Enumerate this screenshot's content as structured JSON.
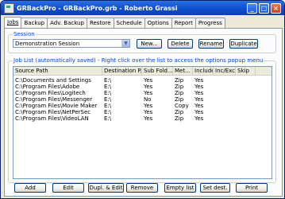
{
  "window": {
    "title": "GRBackPro - GRBackPro.grb - Roberto Grassi"
  },
  "window_controls": {
    "minimize": "_",
    "maximize": "□",
    "close": "×"
  },
  "tabs": [
    "Jobs",
    "Backup",
    "Adv. Backup",
    "Restore",
    "Schedule",
    "Options",
    "Report",
    "Progress"
  ],
  "session": {
    "label": "Session",
    "selected": "Demonstration Session",
    "buttons": {
      "new": "New...",
      "delete": "Delete",
      "rename": "Rename",
      "duplicate": "Duplicate"
    }
  },
  "job_list": {
    "label": "Job List (automatically saved) - Right click over the list to access the options popup menu",
    "columns": [
      "Source Path",
      "Destination P...",
      "Sub Fold...",
      "Met...",
      "Include",
      "Inc/Exc",
      "Skip"
    ],
    "rows": [
      [
        "C:\\Documents and Settings",
        "E:\\",
        "Yes",
        "Zip",
        "Yes",
        "",
        ""
      ],
      [
        "C:\\Program Files\\Adobe",
        "E:\\",
        "Yes",
        "Zip",
        "Yes",
        "",
        ""
      ],
      [
        "C:\\Program Files\\Logitech",
        "E:\\",
        "Yes",
        "Zip",
        "Yes",
        "",
        ""
      ],
      [
        "C:\\Program Files\\Messenger",
        "E:\\",
        "No",
        "Zip",
        "Yes",
        "",
        ""
      ],
      [
        "C:\\Program Files\\Movie Maker",
        "E:\\",
        "Yes",
        "Copy",
        "Yes",
        "",
        ""
      ],
      [
        "C:\\Program Files\\NetPerSec",
        "E:\\",
        "Yes",
        "Zip",
        "Yes",
        "",
        ""
      ],
      [
        "C:\\Program Files\\VideoLAN",
        "E:\\",
        "Yes",
        "Zip",
        "Yes",
        "",
        ""
      ]
    ]
  },
  "actions": {
    "add": "Add",
    "edit": "Edit",
    "dupl_edit": "Dupl. & Edit",
    "remove": "Remove",
    "empty_list": "Empty list",
    "set_dest": "Set dest.",
    "print": "Print"
  }
}
